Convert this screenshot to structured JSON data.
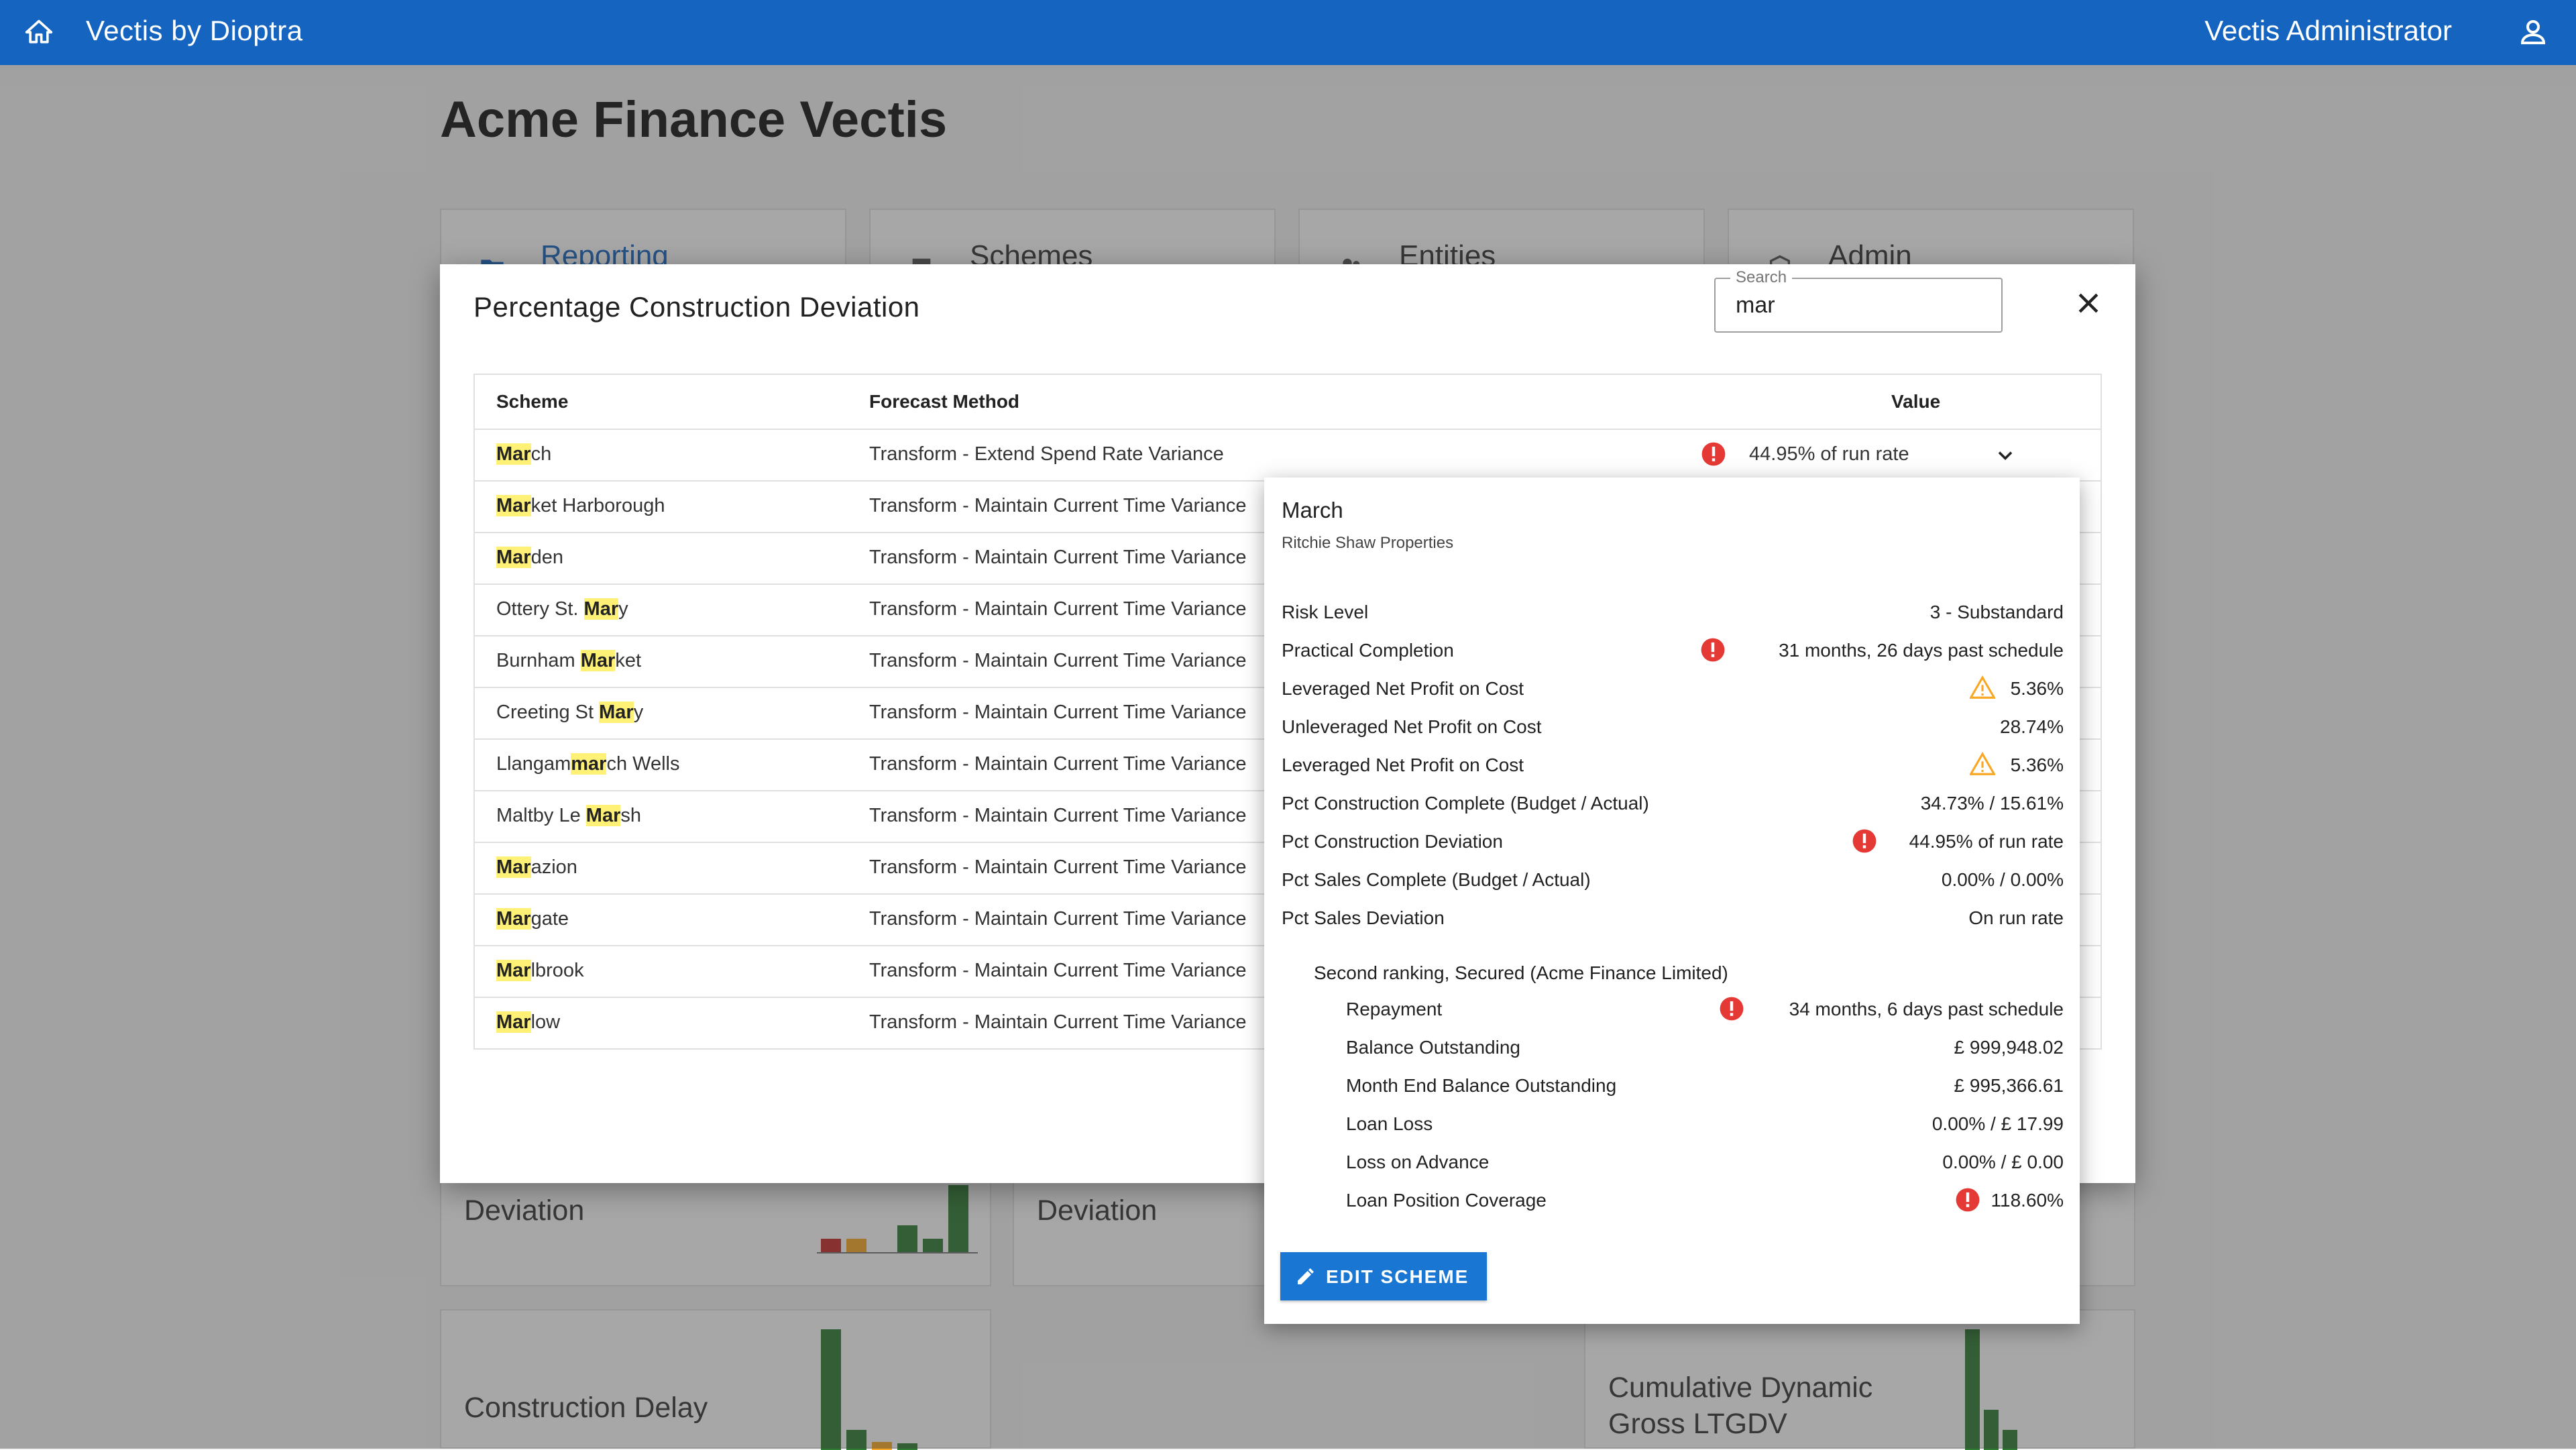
{
  "topbar": {
    "brand": "Vectis by Dioptra",
    "user": "Vectis Administrator"
  },
  "page": {
    "title": "Acme Finance Vectis"
  },
  "nav_cards": [
    {
      "label": "Reporting",
      "icon": "folder-icon"
    },
    {
      "label": "Schemes",
      "icon": "building-icon"
    },
    {
      "label": "Entities",
      "icon": "people-icon"
    },
    {
      "label": "Admin",
      "icon": "shield-icon"
    }
  ],
  "tiles": {
    "deviation_left": "Deviation",
    "deviation_mid": "Deviation",
    "construction_delay": "Construction Delay",
    "cumulative_line1": "Cumulative Dynamic",
    "cumulative_line2": "Gross LTGDV"
  },
  "dialog": {
    "title": "Percentage Construction Deviation",
    "search": {
      "legend": "Search",
      "value": "mar"
    },
    "columns": {
      "scheme": "Scheme",
      "forecast": "Forecast Method",
      "value": "Value"
    },
    "rows": [
      {
        "pre": "",
        "match": "Mar",
        "post": "ch",
        "forecast": "Transform - Extend Spend Rate Variance",
        "value": "44.95% of run rate"
      },
      {
        "pre": "",
        "match": "Mar",
        "post": "ket Harborough",
        "forecast": "Transform - Maintain Current Time Variance"
      },
      {
        "pre": "",
        "match": "Mar",
        "post": "den",
        "forecast": "Transform - Maintain Current Time Variance"
      },
      {
        "pre": "Ottery St. ",
        "match": "Mar",
        "post": "y",
        "forecast": "Transform - Maintain Current Time Variance"
      },
      {
        "pre": "Burnham ",
        "match": "Mar",
        "post": "ket",
        "forecast": "Transform - Maintain Current Time Variance"
      },
      {
        "pre": "Creeting St ",
        "match": "Mar",
        "post": "y",
        "forecast": "Transform - Maintain Current Time Variance"
      },
      {
        "pre": "Llangam",
        "match": "mar",
        "post": "ch Wells",
        "forecast": "Transform - Maintain Current Time Variance"
      },
      {
        "pre": "Maltby Le ",
        "match": "Mar",
        "post": "sh",
        "forecast": "Transform - Maintain Current Time Variance"
      },
      {
        "pre": "",
        "match": "Mar",
        "post": "azion",
        "forecast": "Transform - Maintain Current Time Variance"
      },
      {
        "pre": "",
        "match": "Mar",
        "post": "gate",
        "forecast": "Transform - Maintain Current Time Variance"
      },
      {
        "pre": "",
        "match": "Mar",
        "post": "lbrook",
        "forecast": "Transform - Maintain Current Time Variance"
      },
      {
        "pre": "",
        "match": "Mar",
        "post": "low",
        "forecast": "Transform - Maintain Current Time Variance"
      }
    ]
  },
  "popup": {
    "title": "March",
    "subtitle": "Ritchie Shaw Properties",
    "metrics": [
      {
        "label": "Risk Level",
        "value": "3 - Substandard",
        "icon": ""
      },
      {
        "label": "Practical Completion",
        "value": "31 months, 26 days past schedule",
        "icon": "alert-icon"
      },
      {
        "label": "Leveraged Net Profit on Cost",
        "value": "5.36%",
        "icon": "warning-icon"
      },
      {
        "label": "Unleveraged Net Profit on Cost",
        "value": "28.74%",
        "icon": ""
      },
      {
        "label": "Leveraged Net Profit on Cost",
        "value": "5.36%",
        "icon": "warning-icon"
      },
      {
        "label": "Pct Construction Complete (Budget / Actual)",
        "value": "34.73% / 15.61%",
        "icon": ""
      },
      {
        "label": "Pct Construction Deviation",
        "value": "44.95% of run rate",
        "icon": "alert-icon"
      },
      {
        "label": "Pct Sales Complete (Budget / Actual)",
        "value": "0.00% / 0.00%",
        "icon": ""
      },
      {
        "label": "Pct Sales Deviation",
        "value": "On run rate",
        "icon": ""
      }
    ],
    "loan_group": "Second ranking, Secured (Acme Finance Limited)",
    "loan_metrics": [
      {
        "label": "Repayment",
        "value": "34 months, 6 days past schedule",
        "icon": "alert-icon"
      },
      {
        "label": "Balance Outstanding",
        "value": "£ 999,948.02",
        "icon": ""
      },
      {
        "label": "Month End Balance Outstanding",
        "value": "£ 995,366.61",
        "icon": ""
      },
      {
        "label": "Loan Loss",
        "value": "0.00% / £ 17.99",
        "icon": ""
      },
      {
        "label": "Loss on Advance",
        "value": "0.00% / £ 0.00",
        "icon": ""
      },
      {
        "label": "Loan Position Coverage",
        "value": "118.60%",
        "icon": "alert-icon"
      }
    ],
    "edit_label": "EDIT SCHEME"
  },
  "colors": {
    "brand": "#1565c0",
    "alert": "#e53935",
    "warning": "#fbc02d",
    "highlight": "#fff176",
    "button": "#1976d2"
  }
}
